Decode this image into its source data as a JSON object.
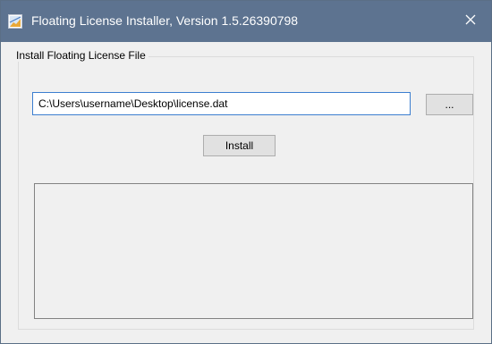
{
  "window": {
    "title": "Floating License Installer, Version 1.5.26390798",
    "app_icon": "installer-app-icon",
    "close_icon": "close-icon",
    "titlebar_color": "#5d7390"
  },
  "group": {
    "title": "Install Floating License File"
  },
  "license_path": {
    "value": "C:\\Users\\username\\Desktop\\license.dat",
    "focus_color": "#3c7ed0"
  },
  "browse_button": {
    "label": "..."
  },
  "install_button": {
    "label": "Install"
  },
  "output": {
    "text": ""
  }
}
